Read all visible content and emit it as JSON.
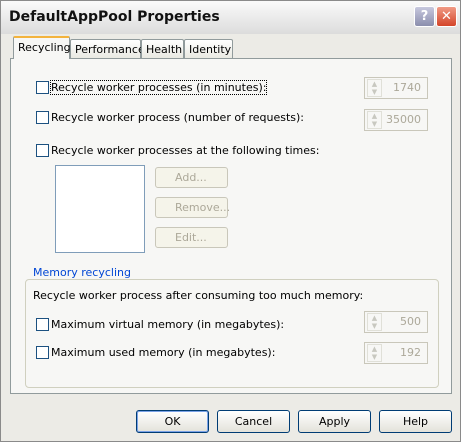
{
  "window": {
    "title": "DefaultAppPool Properties",
    "help_label": "?",
    "close_label": "✕"
  },
  "tabs": [
    {
      "label": "Recycling",
      "selected": true
    },
    {
      "label": "Performance"
    },
    {
      "label": "Health"
    },
    {
      "label": "Identity"
    }
  ],
  "recycling": {
    "minutes": {
      "label": "Recycle worker processes (in minutes):",
      "checked": false,
      "value": "1740"
    },
    "requests": {
      "label": "Recycle worker process (number of requests):",
      "checked": false,
      "value": "35000"
    },
    "times": {
      "label": "Recycle worker processes at the following times:",
      "checked": false
    },
    "add_label": "Add...",
    "remove_label": "Remove...",
    "edit_label": "Edit..."
  },
  "memory": {
    "legend": "Memory recycling",
    "description": "Recycle worker process after consuming too much memory:",
    "virtual": {
      "label": "Maximum virtual memory (in megabytes):",
      "checked": false,
      "value": "500"
    },
    "used": {
      "label": "Maximum used memory (in megabytes):",
      "checked": false,
      "value": "192"
    }
  },
  "buttons": {
    "ok": "OK",
    "cancel": "Cancel",
    "apply": "Apply",
    "help": "Help"
  }
}
